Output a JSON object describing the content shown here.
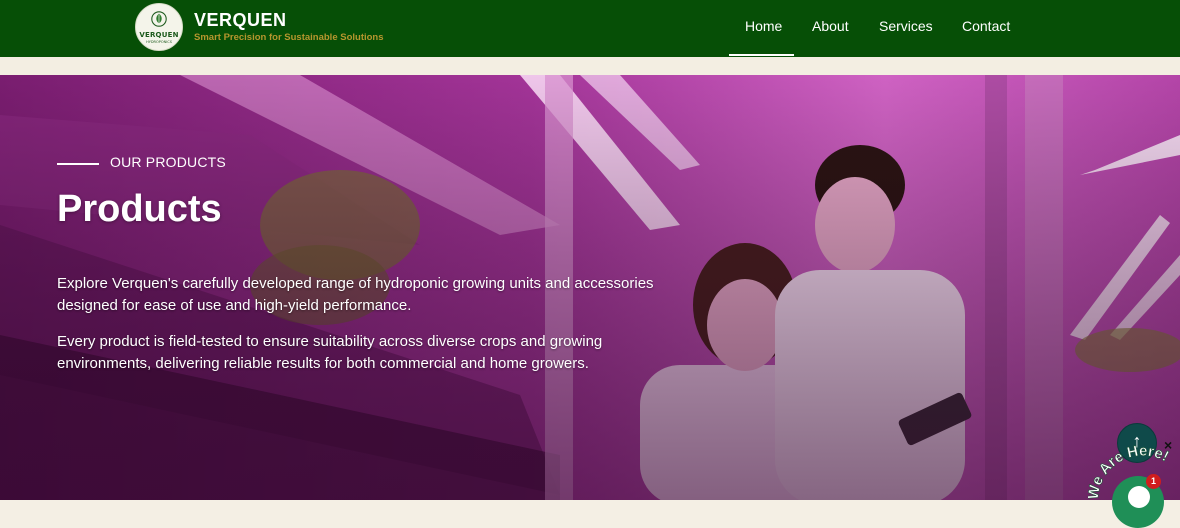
{
  "brand": {
    "logo_text": "VERQUEN",
    "logo_subtext": "HYDROPONICS",
    "name": "VERQUEN",
    "tagline": "Smart Precision for Sustainable Solutions"
  },
  "nav": {
    "items": [
      "Home",
      "About",
      "Services",
      "Contact"
    ],
    "active": "Home"
  },
  "hero": {
    "eyebrow": "OUR PRODUCTS",
    "title": "Products",
    "paragraph_1": "Explore Verquen's carefully developed range of hydroponic growing units and accessories designed for ease of use and high-yield performance.",
    "paragraph_2": "Every product is field-tested to ensure suitability across diverse crops and growing environments, delivering reliable results for both commercial and home growers."
  },
  "widgets": {
    "scroll_top_icon": "arrow-up-icon",
    "close_symbol": "×",
    "chat_label": "We Are Here!",
    "chat_badge_count": "1"
  },
  "colors": {
    "header_bg": "#064f06",
    "tagline": "#b6962e",
    "hero_tint": "#b53aa6",
    "chat_green": "#1f8f57",
    "scroll_btn": "#0f4a4a"
  }
}
